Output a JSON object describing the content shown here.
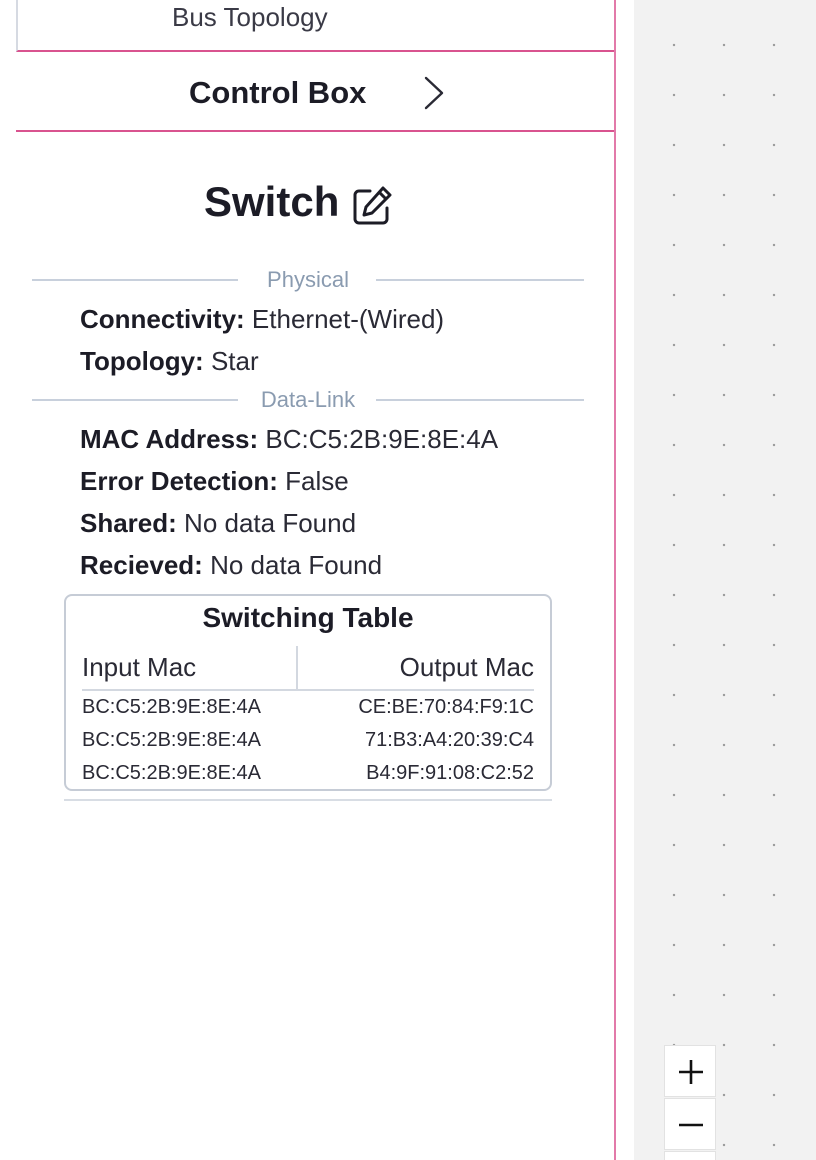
{
  "sidebar": {
    "previous_item": "Bus Topology",
    "control_box_label": "Control Box"
  },
  "device": {
    "title": "Switch"
  },
  "sections": {
    "physical": "Physical",
    "data_link": "Data-Link"
  },
  "fields": {
    "connectivity": {
      "label": "Connectivity:",
      "value": "Ethernet-(Wired)"
    },
    "topology": {
      "label": "Topology:",
      "value": "Star"
    },
    "mac_address": {
      "label": "MAC Address:",
      "value": "BC:C5:2B:9E:8E:4A"
    },
    "error_detection": {
      "label": "Error Detection:",
      "value": "False"
    },
    "shared": {
      "label": "Shared:",
      "value": "No data Found"
    },
    "received": {
      "label": "Recieved:",
      "value": "No data Found"
    }
  },
  "switching_table": {
    "title": "Switching Table",
    "headers": {
      "input": "Input Mac",
      "output": "Output Mac"
    },
    "rows": [
      {
        "input": "BC:C5:2B:9E:8E:4A",
        "output": "CE:BE:70:84:F9:1C"
      },
      {
        "input": "BC:C5:2B:9E:8E:4A",
        "output": "71:B3:A4:20:39:C4"
      },
      {
        "input": "BC:C5:2B:9E:8E:4A",
        "output": "B4:9F:91:08:C2:52"
      }
    ]
  },
  "icons": {
    "chevron": "chevron-right-icon",
    "edit": "edit-icon",
    "zoom_in": "plus-icon",
    "zoom_out": "minus-icon"
  },
  "colors": {
    "accent_border": "#d9538f",
    "divider_text": "#8a9bb0",
    "canvas_bg": "#f2f2f2"
  }
}
